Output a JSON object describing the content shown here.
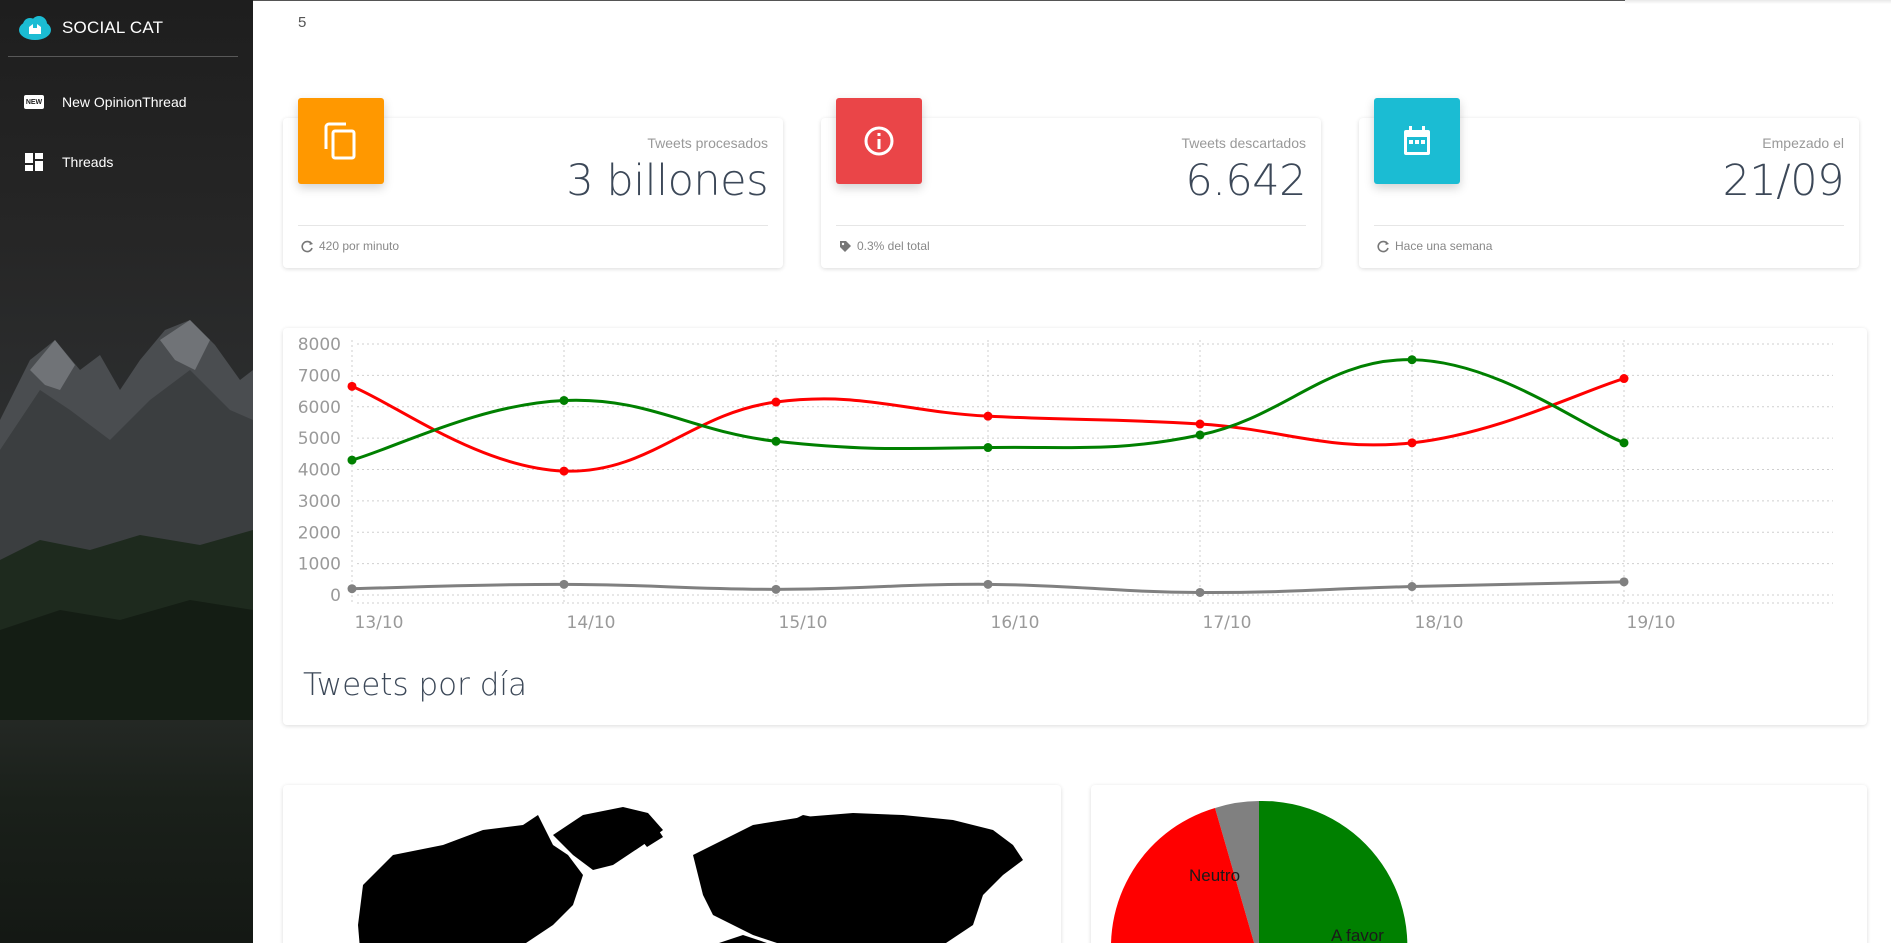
{
  "app": {
    "brand": "SOCIAL CAT"
  },
  "sidebar": {
    "items": [
      {
        "label": "New OpinionThread",
        "icon": "new-badge-icon",
        "badge": "NEW"
      },
      {
        "label": "Threads",
        "icon": "dashboard-icon"
      }
    ]
  },
  "header": {
    "page_number": "5"
  },
  "stats": [
    {
      "category": "Tweets procesados",
      "value": "3 billones",
      "footer": "420 por minuto",
      "icon": "copy-icon",
      "footer_icon": "refresh-icon",
      "color": "#ff9800"
    },
    {
      "category": "Tweets descartados",
      "value": "6.642",
      "footer": "0.3% del total",
      "icon": "info-icon",
      "footer_icon": "tag-icon",
      "color": "#ea4548"
    },
    {
      "category": "Empezado el",
      "value": "21/09",
      "footer": "Hace una semana",
      "icon": "calendar-icon",
      "footer_icon": "refresh-icon",
      "color": "#1bbcd3"
    }
  ],
  "chart_data": {
    "type": "line",
    "title": "Tweets por día",
    "x": [
      "13/10",
      "14/10",
      "15/10",
      "16/10",
      "17/10",
      "18/10",
      "19/10"
    ],
    "y_ticks": [
      "0",
      "1000",
      "2000",
      "3000",
      "4000",
      "5000",
      "6000",
      "7000",
      "8000"
    ],
    "ylim": [
      0,
      8000
    ],
    "grid": true,
    "series": [
      {
        "color": "#ff0000",
        "values": [
          6650,
          3950,
          6150,
          5700,
          5450,
          4850,
          6900
        ]
      },
      {
        "color": "#008000",
        "values": [
          4300,
          6200,
          4900,
          4700,
          5100,
          7500,
          4850
        ]
      },
      {
        "color": "#808080",
        "values": [
          200,
          340,
          180,
          340,
          80,
          270,
          420
        ]
      }
    ]
  },
  "pie": {
    "labels": [
      "Neutro",
      "A favor"
    ],
    "colors": {
      "a_favor": "#008000",
      "en_contra": "#ff0000",
      "neutro": "#808080"
    }
  },
  "map": {
    "icon": "world-map"
  }
}
